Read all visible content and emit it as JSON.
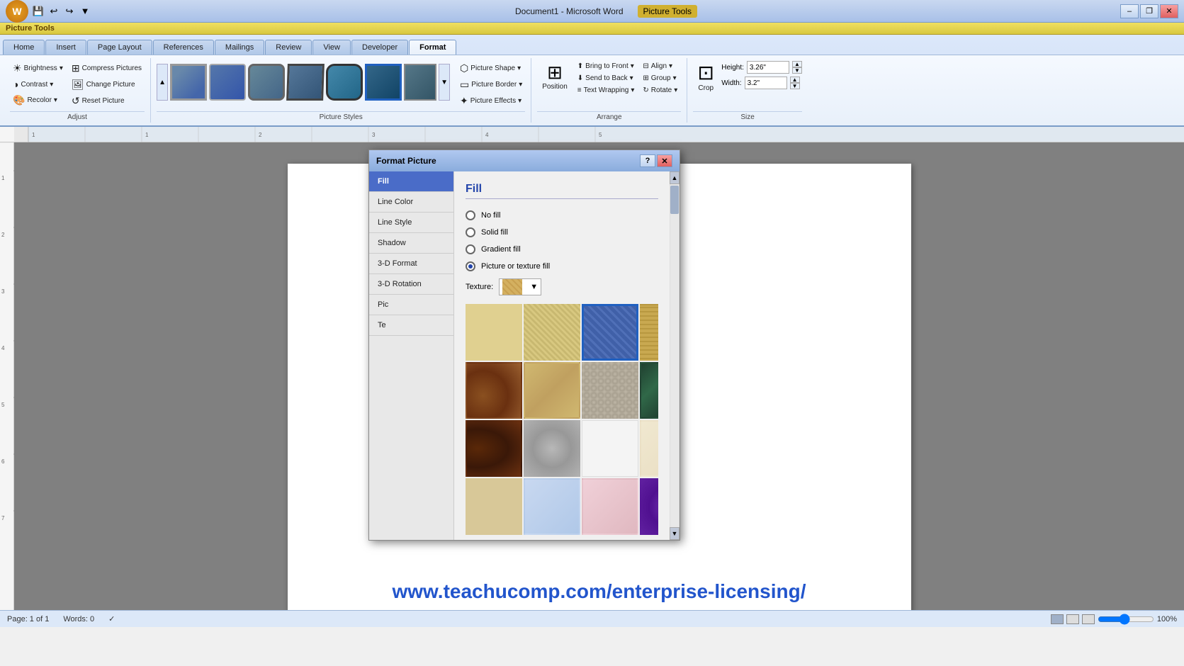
{
  "titleBar": {
    "appTitle": "Document1 - Microsoft Word",
    "pictureTools": "Picture Tools",
    "minimizeIcon": "–",
    "restoreIcon": "❐",
    "closeIcon": "✕"
  },
  "quickAccess": {
    "saveIcon": "💾",
    "undoIcon": "↩",
    "redoIcon": "↪",
    "dropdownIcon": "▼"
  },
  "tabs": [
    {
      "label": "Home",
      "active": false
    },
    {
      "label": "Insert",
      "active": false
    },
    {
      "label": "Page Layout",
      "active": false
    },
    {
      "label": "References",
      "active": false
    },
    {
      "label": "Mailings",
      "active": false
    },
    {
      "label": "Review",
      "active": false
    },
    {
      "label": "View",
      "active": false
    },
    {
      "label": "Developer",
      "active": false
    },
    {
      "label": "Format",
      "active": true
    }
  ],
  "pictureToolsLabel": "Picture Tools",
  "ribbon": {
    "adjustGroup": {
      "label": "Adjust",
      "brightnessLabel": "Brightness",
      "contrastLabel": "Contrast",
      "recolorLabel": "Recolor",
      "compressPicturesLabel": "Compress Pictures",
      "changePictureLabel": "Change Picture",
      "resetPictureLabel": "Reset Picture"
    },
    "pictureStylesGroup": {
      "label": "Picture Styles"
    },
    "pictureStyleControls": {
      "pictureShapeLabel": "Picture Shape",
      "pictureBorderLabel": "Picture Border",
      "pictureEffectsLabel": "Picture Effects"
    },
    "arrangeGroup": {
      "label": "Arrange",
      "positionLabel": "Position",
      "bringToFrontLabel": "Bring to Front",
      "sendToBackLabel": "Send to Back",
      "textWrappingLabel": "Text Wrapping",
      "alignLabel": "Align",
      "groupLabel": "Group",
      "rotateLabel": "Rotate"
    },
    "sizeGroup": {
      "label": "Size",
      "cropLabel": "Crop",
      "heightLabel": "Height:",
      "heightValue": "3.26\"",
      "widthLabel": "Width:",
      "widthValue": "3.2\""
    }
  },
  "dialog": {
    "title": "Format Picture",
    "navItems": [
      {
        "label": "Fill",
        "active": true
      },
      {
        "label": "Line Color",
        "active": false
      },
      {
        "label": "Line Style",
        "active": false
      },
      {
        "label": "Shadow",
        "active": false
      },
      {
        "label": "3-D Format",
        "active": false
      },
      {
        "label": "3-D Rotation",
        "active": false
      },
      {
        "label": "Pic",
        "active": false
      },
      {
        "label": "Te",
        "active": false
      }
    ],
    "content": {
      "sectionTitle": "Fill",
      "options": [
        {
          "label": "No fill",
          "selected": false
        },
        {
          "label": "Solid fill",
          "selected": false
        },
        {
          "label": "Gradient fill",
          "selected": false
        },
        {
          "label": "Picture or texture fill",
          "selected": true
        }
      ],
      "textureLabel": "Texture:"
    }
  },
  "statusBar": {
    "pageInfo": "Page: 1 of 1",
    "wordCount": "Words: 0",
    "checkmark": "✓"
  },
  "watermark": "www.teachucomp.com/enterprise-licensing/"
}
